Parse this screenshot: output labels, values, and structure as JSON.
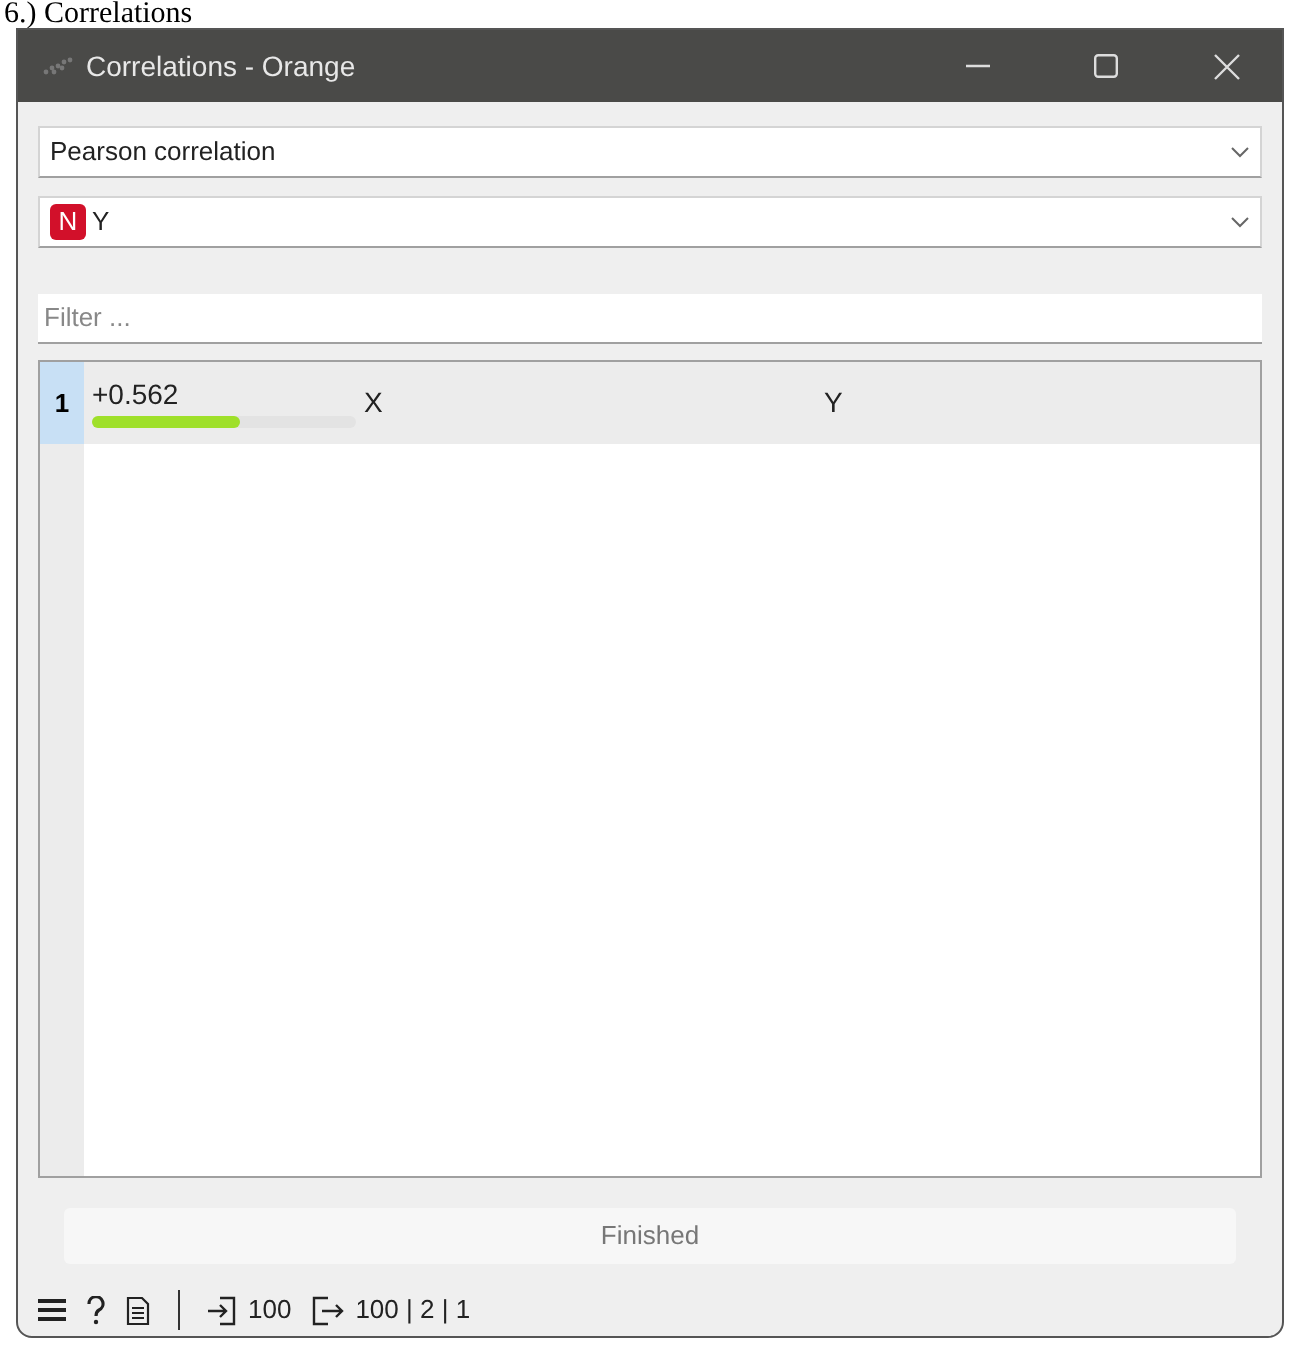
{
  "caption": "6.) Correlations",
  "window": {
    "title": "Correlations - Orange"
  },
  "method_combo": {
    "value": "Pearson correlation"
  },
  "feature_combo": {
    "badge": "N",
    "value": "Y"
  },
  "filter": {
    "placeholder": "Filter ..."
  },
  "table": {
    "rows": [
      {
        "index": "1",
        "value": "+0.562",
        "level": 0.562,
        "column_2": "X",
        "column_3": "Y",
        "selected": true
      }
    ]
  },
  "status": "Finished",
  "status_bar": {
    "input_count": "100",
    "output_count": "100 | 2 | 1"
  }
}
